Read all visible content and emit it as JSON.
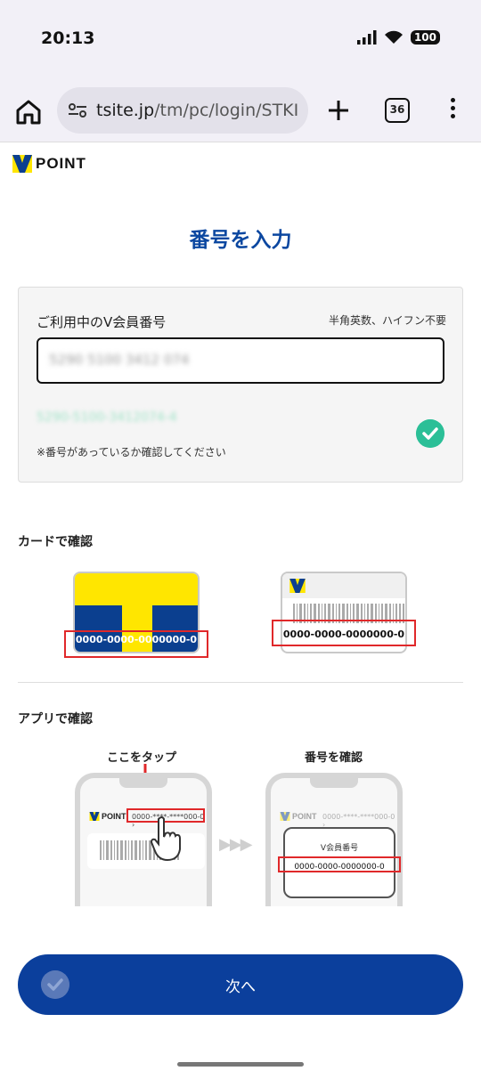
{
  "status_bar": {
    "time": "20:13",
    "battery": "100"
  },
  "browser": {
    "url_host": "tsite.jp",
    "url_path": "/tm/pc/login/STKI",
    "tab_count": "36"
  },
  "logo": {
    "text": "POINT"
  },
  "page": {
    "title": "番号を入力"
  },
  "form": {
    "label": "ご利用中のV会員番号",
    "hint": "半角英数、ハイフン不要",
    "input_value": "5290 5100 3412 074",
    "formatted_value": "5290-5100-3412074-4",
    "confirm_note": "※番号があっているか確認してください"
  },
  "card_section": {
    "heading": "カードで確認",
    "tcard_number": "0000-0000-0000000-0",
    "barcode_card_number": "0000-0000-0000000-0"
  },
  "app_section": {
    "heading": "アプリで確認",
    "step1_caption": "ここをタップ",
    "step2_caption": "番号を確認",
    "mini_logo": "POINT",
    "mini_masked_number": "0000-****-****000-0 ›",
    "popup_title": "V会員番号",
    "popup_number": "0000-0000-0000000-0"
  },
  "next_button": {
    "label": "次へ"
  },
  "colors": {
    "brand_blue": "#0b3f9c",
    "title_blue": "#0b47a0",
    "tcard_yellow": "#ffe600",
    "check_green": "#2bbf97",
    "highlight_red": "#e0282a"
  }
}
